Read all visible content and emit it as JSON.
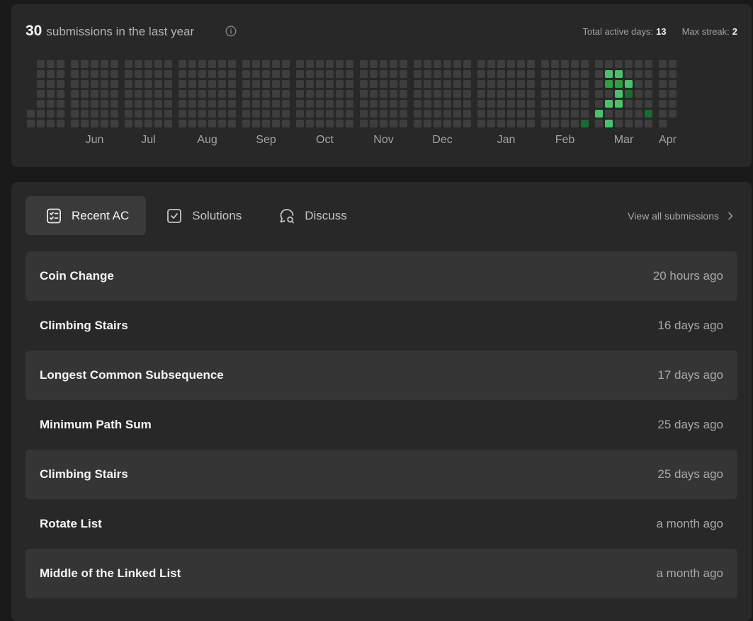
{
  "heatmap": {
    "count": "30",
    "label": "submissions in the last year",
    "stats": {
      "active_label": "Total active days:",
      "active_value": "13",
      "streak_label": "Max streak:",
      "streak_value": "2"
    },
    "months": [
      "Jun",
      "Jul",
      "Aug",
      "Sep",
      "Oct",
      "Nov",
      "Dec",
      "Jan",
      "Feb",
      "Mar",
      "Apr"
    ],
    "colors": {
      "empty": "#3e3e3e",
      "l1": "#196c2e",
      "l2": "#2ea043",
      "l3": "#4ac26b"
    },
    "active_cells": [
      {
        "week": 1,
        "day": 1,
        "level": 3
      },
      {
        "week": 1,
        "day": 2,
        "level": 2
      },
      {
        "week": 2,
        "day": 2,
        "level": 2
      },
      {
        "week": 2,
        "day": 3,
        "level": 3
      },
      {
        "week": 1,
        "day": 4,
        "level": 3
      },
      {
        "week": 2,
        "day": 4,
        "level": 3
      },
      {
        "week": 1,
        "day": 6,
        "level": 3
      },
      {
        "week": -1,
        "day": 6,
        "level": 1
      },
      {
        "week": 0,
        "day": 5,
        "level": 3
      },
      {
        "week": 2,
        "day": 1,
        "level": 3
      },
      {
        "week": 3,
        "day": 2,
        "level": 3
      },
      {
        "week": 3,
        "day": 3,
        "level": 1
      },
      {
        "week": 5,
        "day": 5,
        "level": 1
      }
    ]
  },
  "tabs": [
    {
      "label": "Recent AC"
    },
    {
      "label": "Solutions"
    },
    {
      "label": "Discuss"
    }
  ],
  "view_all": "View all submissions",
  "submissions": [
    {
      "title": "Coin Change",
      "time": "20 hours ago"
    },
    {
      "title": "Climbing Stairs",
      "time": "16 days ago"
    },
    {
      "title": "Longest Common Subsequence",
      "time": "17 days ago"
    },
    {
      "title": "Minimum Path Sum",
      "time": "25 days ago"
    },
    {
      "title": "Climbing Stairs",
      "time": "25 days ago"
    },
    {
      "title": "Rotate List",
      "time": "a month ago"
    },
    {
      "title": "Middle of the Linked List",
      "time": "a month ago"
    }
  ]
}
